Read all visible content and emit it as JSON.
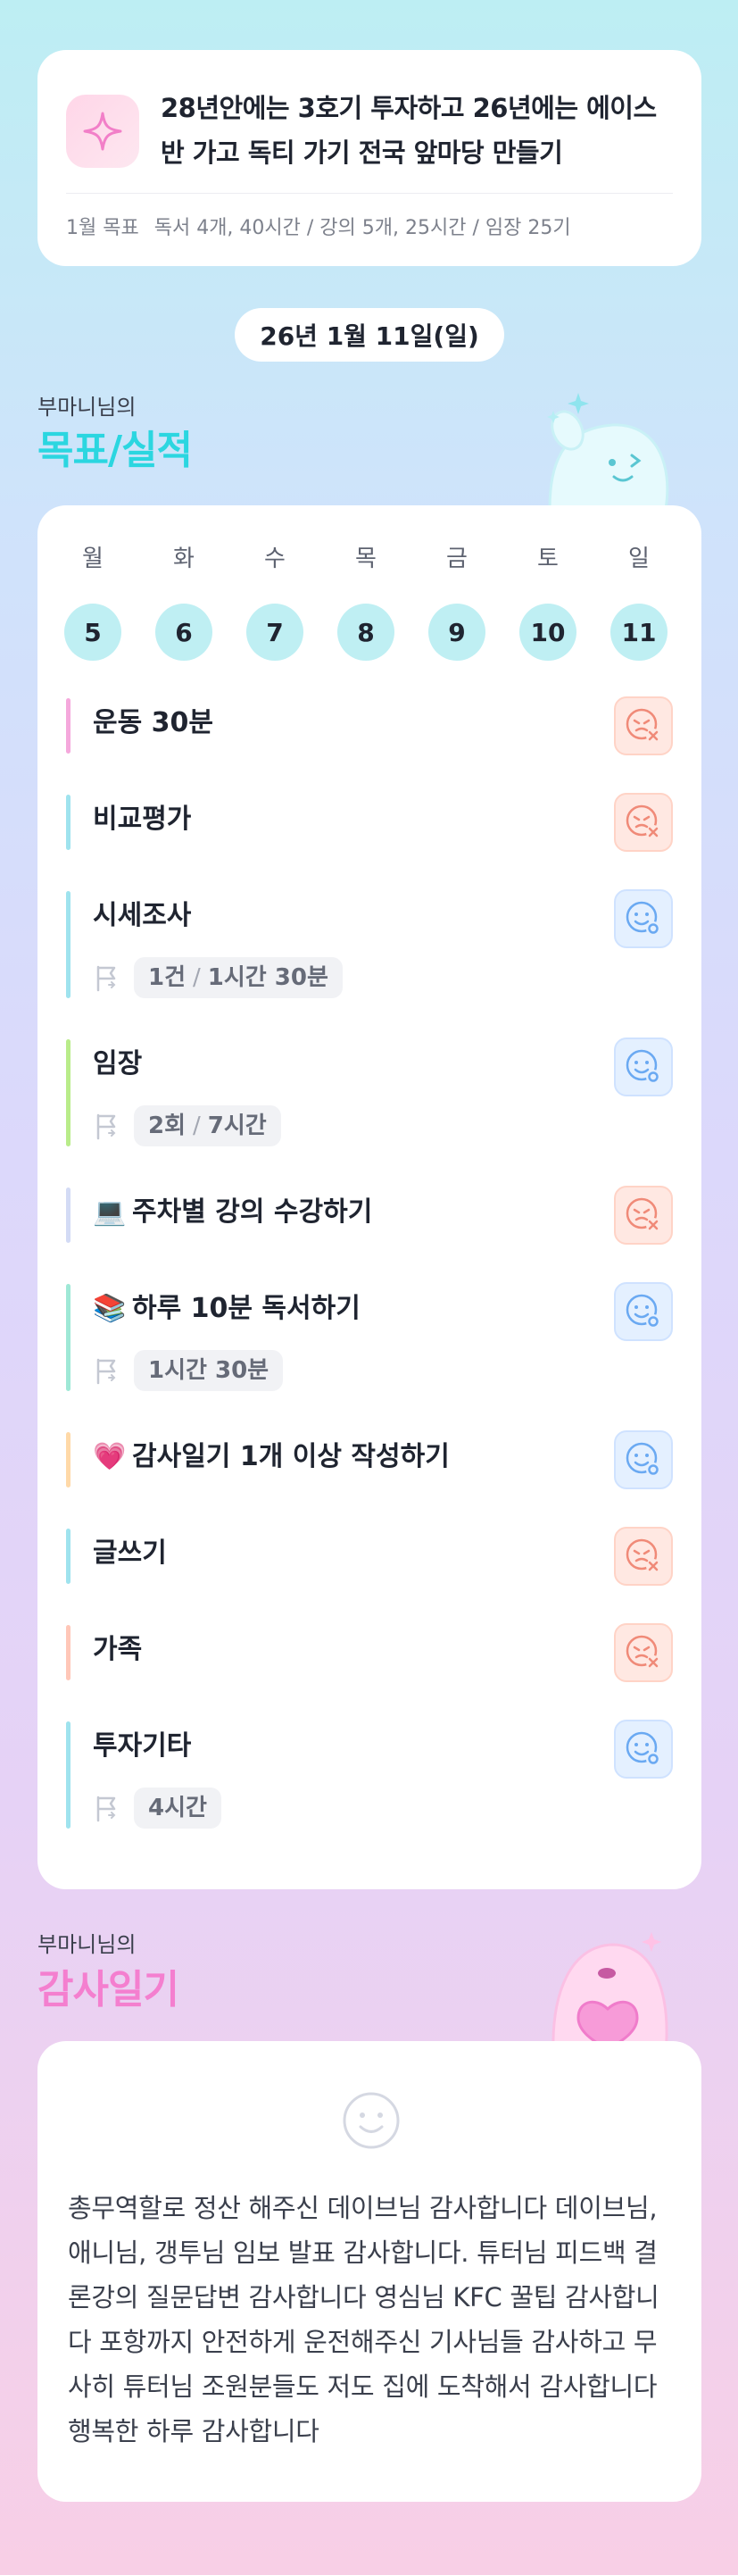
{
  "goal": {
    "icon": "sparkle-icon",
    "title": "28년안에는 3호기 투자하고 26년에는 에이스반 가고 독티 가기 전국 앞마당 만들기",
    "month_label": "1월 목표",
    "month_detail": "독서 4개, 40시간 / 강의 5개, 25시간 / 임장 25기"
  },
  "date": "26년 1월 11일(일)",
  "goals_section": {
    "owner": "부마니님의",
    "title": "목표/실적"
  },
  "week": {
    "labels": [
      "월",
      "화",
      "수",
      "목",
      "금",
      "토",
      "일"
    ],
    "numbers": [
      "5",
      "6",
      "7",
      "8",
      "9",
      "10",
      "11"
    ]
  },
  "tasks": [
    {
      "name": "운동 30분",
      "status": "not-done",
      "color": "#f5a8dc"
    },
    {
      "name": "비교평가",
      "status": "not-done",
      "color": "#9fe3ee"
    },
    {
      "name": "시세조사",
      "status": "done",
      "color": "#9fe3ee",
      "meta": {
        "a": "1건",
        "b": "1시간 30분"
      }
    },
    {
      "name": "임장",
      "status": "done",
      "color": "#b9ec8a",
      "meta": {
        "a": "2회",
        "b": "7시간"
      }
    },
    {
      "name": "주차별 강의 수강하기",
      "emoji": "💻",
      "status": "not-done",
      "color": "#d3dbf5"
    },
    {
      "name": "하루 10분 독서하기",
      "emoji": "📚",
      "status": "done",
      "color": "#9fe8d6",
      "meta": {
        "a": "1시간 30분"
      }
    },
    {
      "name": "감사일기 1개 이상 작성하기",
      "emoji": "💗",
      "status": "done",
      "color": "#ffd9a8"
    },
    {
      "name": "글쓰기",
      "status": "not-done",
      "color": "#9fe3ee"
    },
    {
      "name": "가족",
      "status": "not-done",
      "color": "#ffc7b8"
    },
    {
      "name": "투자기타",
      "status": "done",
      "color": "#9fe3ee",
      "meta": {
        "a": "4시간"
      }
    }
  ],
  "diary_section": {
    "owner": "부마니님의",
    "title": "감사일기"
  },
  "diary": {
    "icon": "smile-face-icon",
    "text": "총무역할로 정산 해주신 데이브님 감사합니다 데이브님, 애니님, 갱투님 임보 발표 감사합니다. 튜터님 피드백 결론강의 질문답변 감사합니다  영심님 KFC 꿀팁 감사합니다 포항까지 안전하게 운전해주신 기사님들 감사하고 무사히 튜터님 조원분들도 저도 집에 도착해서 감사합니다 행복한 하루 감사합니다"
  },
  "colors": {
    "accent_cyan": "#2bd6e0",
    "accent_pink": "#f47fcf",
    "not_done": "#f08a78",
    "done": "#6aa9f2"
  }
}
